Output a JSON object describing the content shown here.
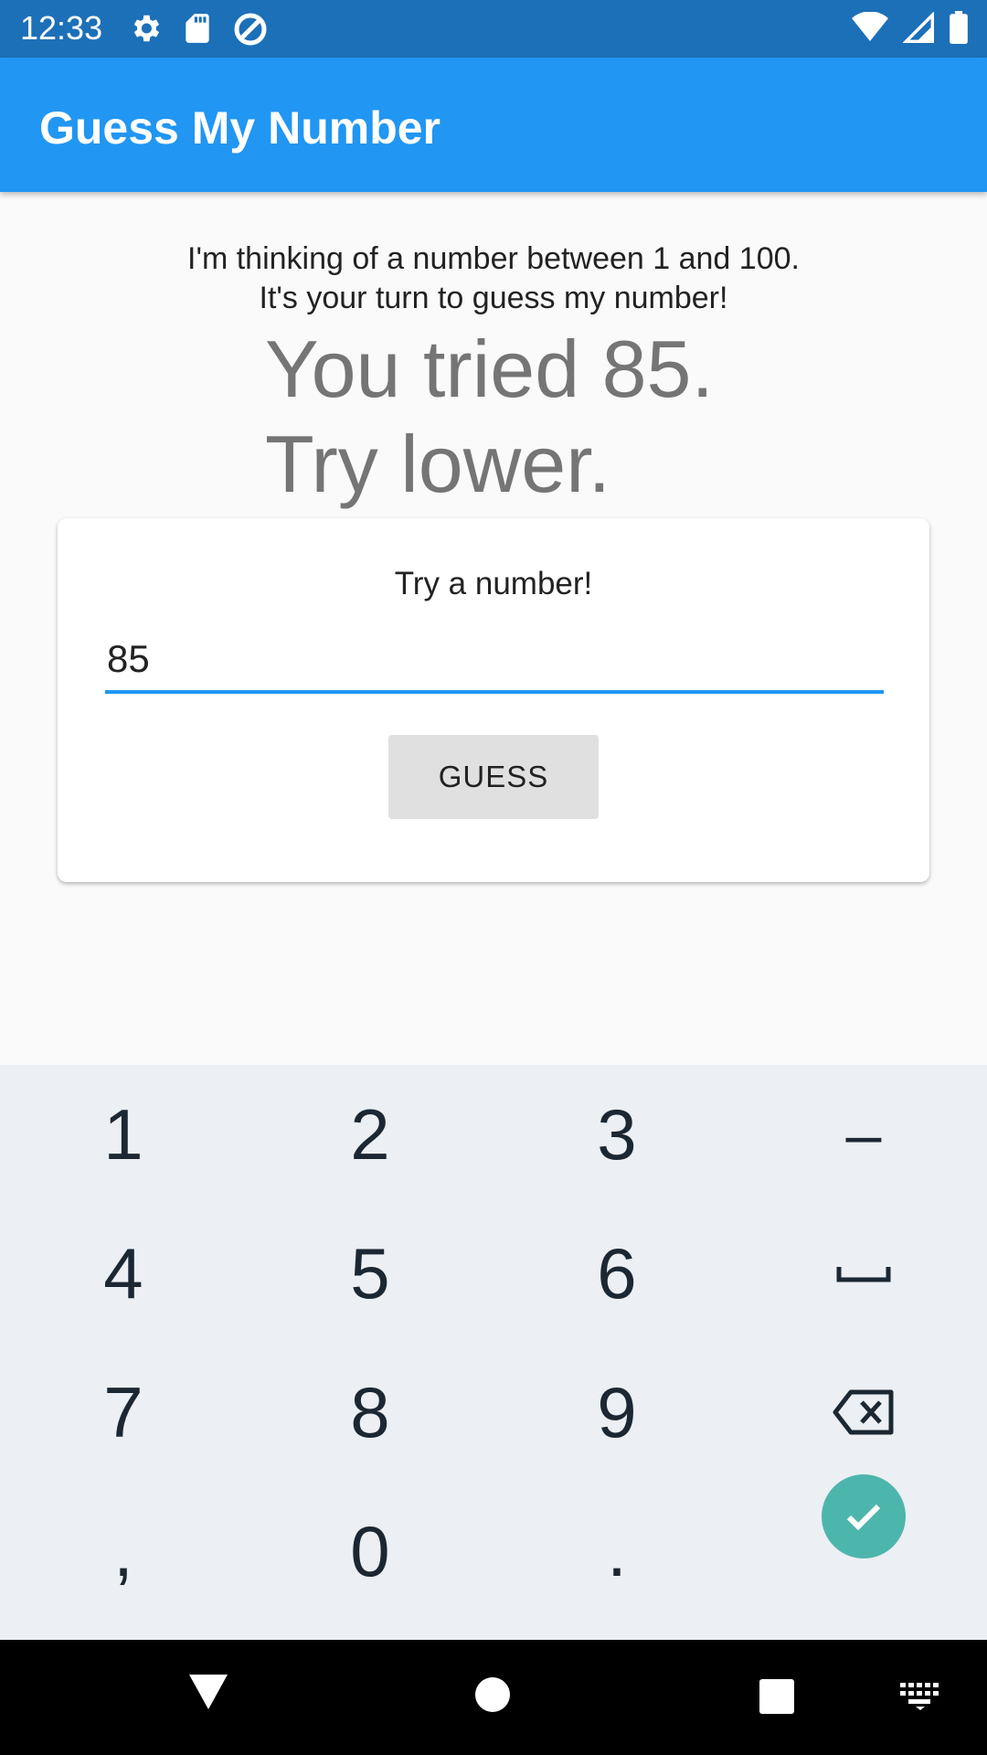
{
  "status_bar": {
    "time": "12:33",
    "icons_left": [
      "settings-icon",
      "sd-card-icon",
      "data-saver-icon"
    ],
    "icons_right": [
      "wifi-icon",
      "cell-signal-icon",
      "battery-icon"
    ]
  },
  "app_bar": {
    "title": "Guess My Number",
    "color": "#2196f3"
  },
  "intro": {
    "line1": "I'm thinking of a number between 1 and 100.",
    "line2": "It's your turn to guess my number!"
  },
  "result": {
    "line1": "You tried 85.",
    "line2": "Try lower."
  },
  "card": {
    "label": "Try a number!",
    "input_value": "85",
    "button_label": "GUESS"
  },
  "keyboard": {
    "keys": [
      "1",
      "2",
      "3",
      "–",
      "4",
      "5",
      "6",
      "␣",
      "7",
      "8",
      "9",
      "⌫",
      ",",
      "0",
      ".",
      "✓"
    ],
    "done_color": "#4db6ac"
  },
  "nav_bar": {
    "buttons": [
      "back-icon",
      "home-icon",
      "recents-icon",
      "keyboard-switch-icon"
    ]
  }
}
